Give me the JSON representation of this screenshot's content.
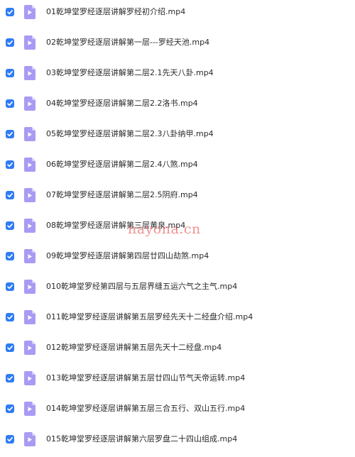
{
  "colors": {
    "checkbox": "#2f7cf6",
    "icon_bg": "#a79bf4",
    "icon_fold": "#d6d0fb",
    "watermark": "#e64e4e"
  },
  "icon_names": {
    "checkbox": "checkmark-icon",
    "file": "video-file-icon"
  },
  "files": [
    {
      "name": "01乾坤堂罗经逐层讲解罗经初介绍.mp4",
      "checked": true
    },
    {
      "name": "02乾坤堂罗经逐层讲解第一层---罗经天池.mp4",
      "checked": true
    },
    {
      "name": "03乾坤堂罗经逐层讲解第二层2.1先天八卦.mp4",
      "checked": true
    },
    {
      "name": "04乾坤堂罗经逐层讲解第二层2.2洛书.mp4",
      "checked": true
    },
    {
      "name": "05乾坤堂罗经逐层讲解第二层2.3八卦纳甲.mp4",
      "checked": true
    },
    {
      "name": "06乾坤堂罗经逐层讲解第二层2.4八煞.mp4",
      "checked": true
    },
    {
      "name": "07乾坤堂罗经逐层讲解第二层2.5阴府.mp4",
      "checked": true
    },
    {
      "name": "08乾坤堂罗经逐层讲解第三层黄泉.mp4",
      "checked": true
    },
    {
      "name": "09乾坤堂罗经逐层讲解第四层廿四山劫煞.mp4",
      "checked": true
    },
    {
      "name": "010乾坤堂罗经第四层与五层界缝五运六气之主气.mp4",
      "checked": true
    },
    {
      "name": "011乾坤堂罗经逐层讲解第五层罗经先天十二经盘介绍.mp4",
      "checked": true
    },
    {
      "name": "012乾坤堂罗经逐层讲解第五层先天十二经盘.mp4",
      "checked": true
    },
    {
      "name": "013乾坤堂罗经逐层讲解第五层廿四山节气天帝运转.mp4",
      "checked": true
    },
    {
      "name": "014乾坤堂罗经逐层讲解第五层三合五行、双山五行.mp4",
      "checked": true
    },
    {
      "name": "015乾坤堂罗经逐层讲解第六层罗盘二十四山组成.mp4",
      "checked": true
    }
  ],
  "watermark": "nayona.cn"
}
